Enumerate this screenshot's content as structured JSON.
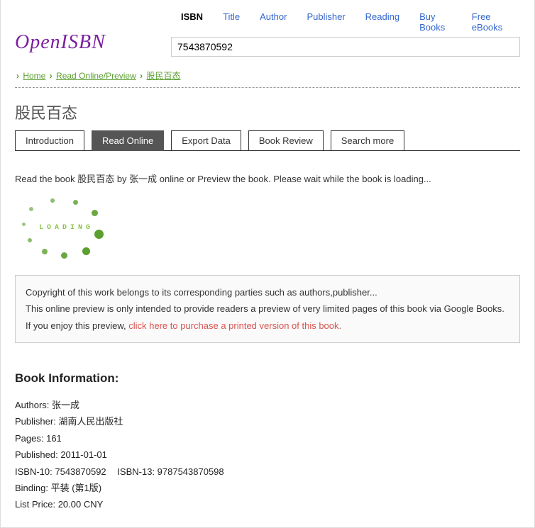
{
  "logo": "OpenISBN",
  "nav": {
    "isbn": "ISBN",
    "title": "Title",
    "author": "Author",
    "publisher": "Publisher",
    "reading": "Reading",
    "buy": "Buy Books",
    "free": "Free eBooks"
  },
  "search": {
    "value": "7543870592"
  },
  "breadcrumbs": {
    "home": "Home",
    "read_online": "Read Online/Preview",
    "title": "股民百态"
  },
  "book_title": "股民百态",
  "tabs": {
    "introduction": "Introduction",
    "read_online": "Read Online",
    "export": "Export Data",
    "review": "Book Review",
    "search_more": "Search more"
  },
  "loading_pre": "Read the book ",
  "loading_title": "股民百态",
  "loading_by": " by ",
  "loading_author": "张一成",
  "loading_post": " online or Preview the book. Please wait while the book is loading...",
  "spinner_label": "LOADING",
  "notice": {
    "line1": "Copyright of this work belongs to its corresponding parties such as authors,publisher...",
    "line2": "This online preview is only intended to provide readers a preview of very limited pages of this book via Google Books.",
    "line3_pre": "If you enjoy this preview, ",
    "line3_link": "click here to purchase a printed version of this book."
  },
  "info_heading": "Book Information:",
  "info": {
    "authors_label": "Authors: ",
    "authors_value": "张一成",
    "publisher_label": "Publisher: ",
    "publisher_value": "湖南人民出版社",
    "pages_label": "Pages: ",
    "pages_value": "161",
    "published_label": "Published: ",
    "published_value": "2011-01-01",
    "isbn10_label": "ISBN-10: ",
    "isbn10_value": "7543870592",
    "isbn13_label": "ISBN-13: ",
    "isbn13_value": "9787543870598",
    "binding_label": "Binding: ",
    "binding_value": "平装 (第1版)",
    "listprice_label": "List Price: ",
    "listprice_value": "20.00 CNY"
  }
}
